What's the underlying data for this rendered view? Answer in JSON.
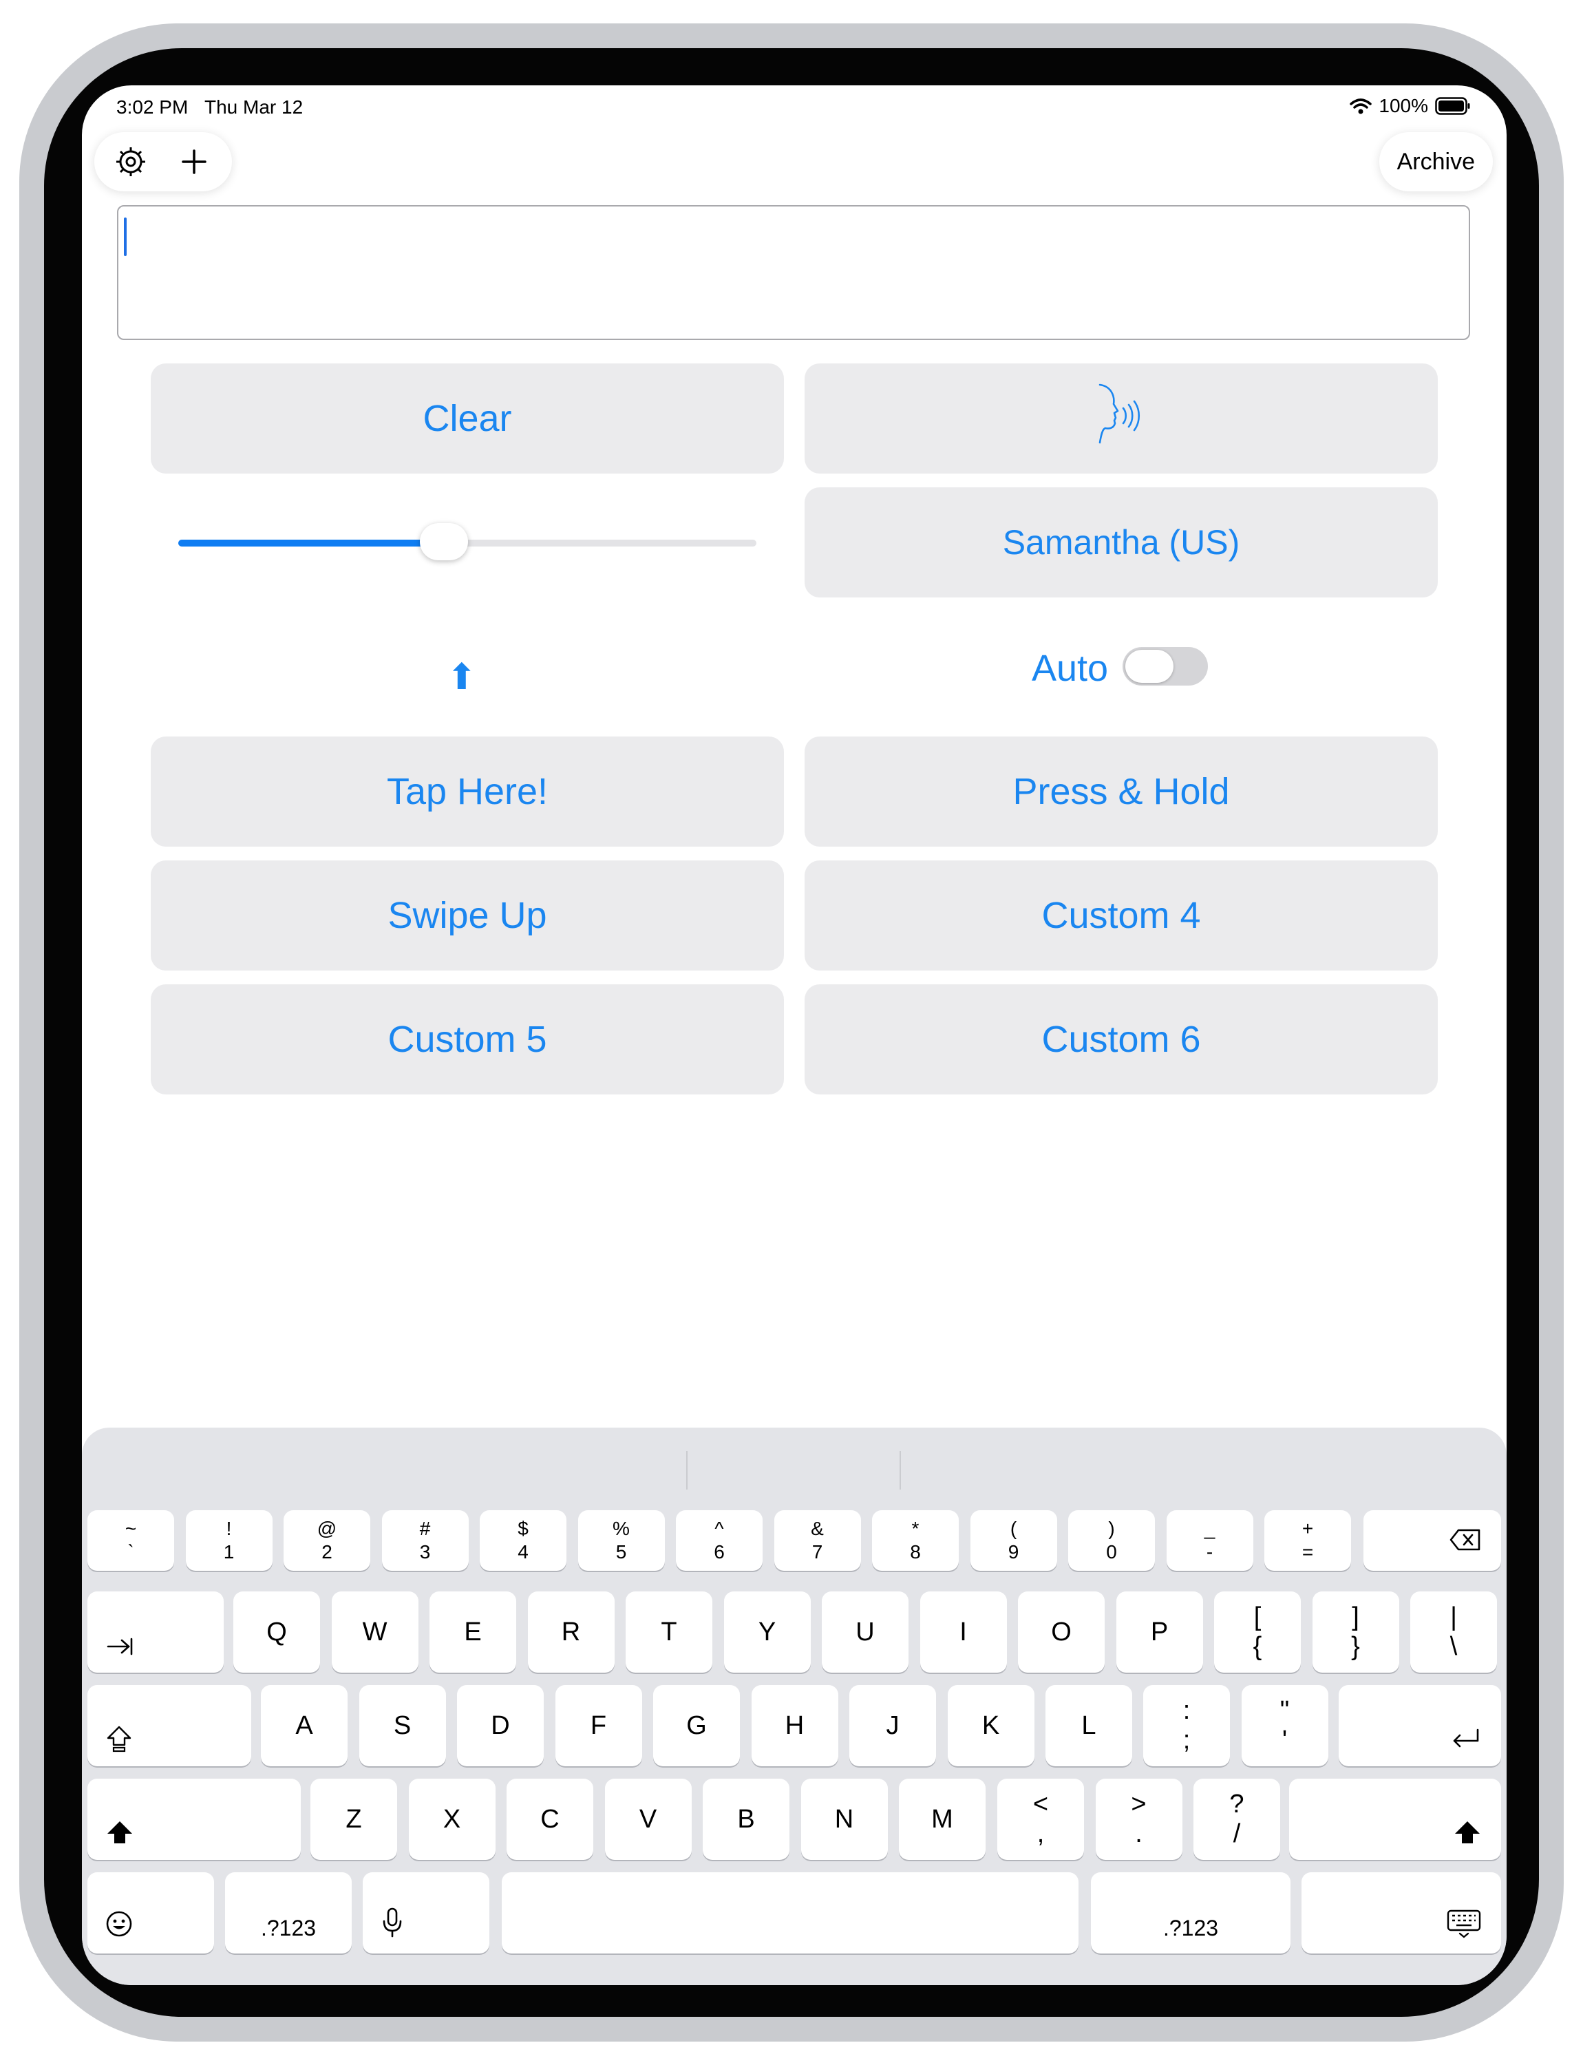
{
  "status_bar": {
    "time": "3:02 PM",
    "date": "Thu Mar 12",
    "battery": "100%"
  },
  "toolbar": {
    "settings_icon": "gear-icon",
    "add_icon": "plus-icon",
    "archive_label": "Archive"
  },
  "text_input": {
    "value": ""
  },
  "buttons": {
    "clear": "Clear",
    "speak_icon": "speaking-head-icon",
    "voice": "Samantha (US)",
    "tap_here": "Tap Here!",
    "press_hold": "Press & Hold",
    "swipe_up": "Swipe Up",
    "custom4": "Custom 4",
    "custom5": "Custom 5",
    "custom6": "Custom 6"
  },
  "speech_rate_slider": {
    "value": 0.46
  },
  "auto_toggle": {
    "label": "Auto",
    "on": false
  },
  "keyboard": {
    "row1": [
      {
        "top": "~",
        "bottom": "`"
      },
      {
        "top": "!",
        "bottom": "1"
      },
      {
        "top": "@",
        "bottom": "2"
      },
      {
        "top": "#",
        "bottom": "3"
      },
      {
        "top": "$",
        "bottom": "4"
      },
      {
        "top": "%",
        "bottom": "5"
      },
      {
        "top": "^",
        "bottom": "6"
      },
      {
        "top": "&",
        "bottom": "7"
      },
      {
        "top": "*",
        "bottom": "8"
      },
      {
        "top": "(",
        "bottom": "9"
      },
      {
        "top": ")",
        "bottom": "0"
      },
      {
        "top": "_",
        "bottom": "-"
      },
      {
        "top": "+",
        "bottom": "="
      }
    ],
    "row2": [
      "Q",
      "W",
      "E",
      "R",
      "T",
      "Y",
      "U",
      "I",
      "O",
      "P"
    ],
    "row2_extra": [
      {
        "top": "[",
        "bottom": "{"
      },
      {
        "top": "]",
        "bottom": "}"
      },
      {
        "top": "|",
        "bottom": "\\"
      }
    ],
    "row3": [
      "A",
      "S",
      "D",
      "F",
      "G",
      "H",
      "J",
      "K",
      "L"
    ],
    "row3_extra": [
      {
        "top": ":",
        "bottom": ";"
      },
      {
        "top": "\"",
        "bottom": "'"
      }
    ],
    "row4": [
      "Z",
      "X",
      "C",
      "V",
      "B",
      "N",
      "M"
    ],
    "row4_extra": [
      {
        "top": "<",
        "bottom": ","
      },
      {
        "top": ">",
        "bottom": "."
      },
      {
        "top": "?",
        "bottom": "/"
      }
    ],
    "numbers_label": ".?123"
  }
}
